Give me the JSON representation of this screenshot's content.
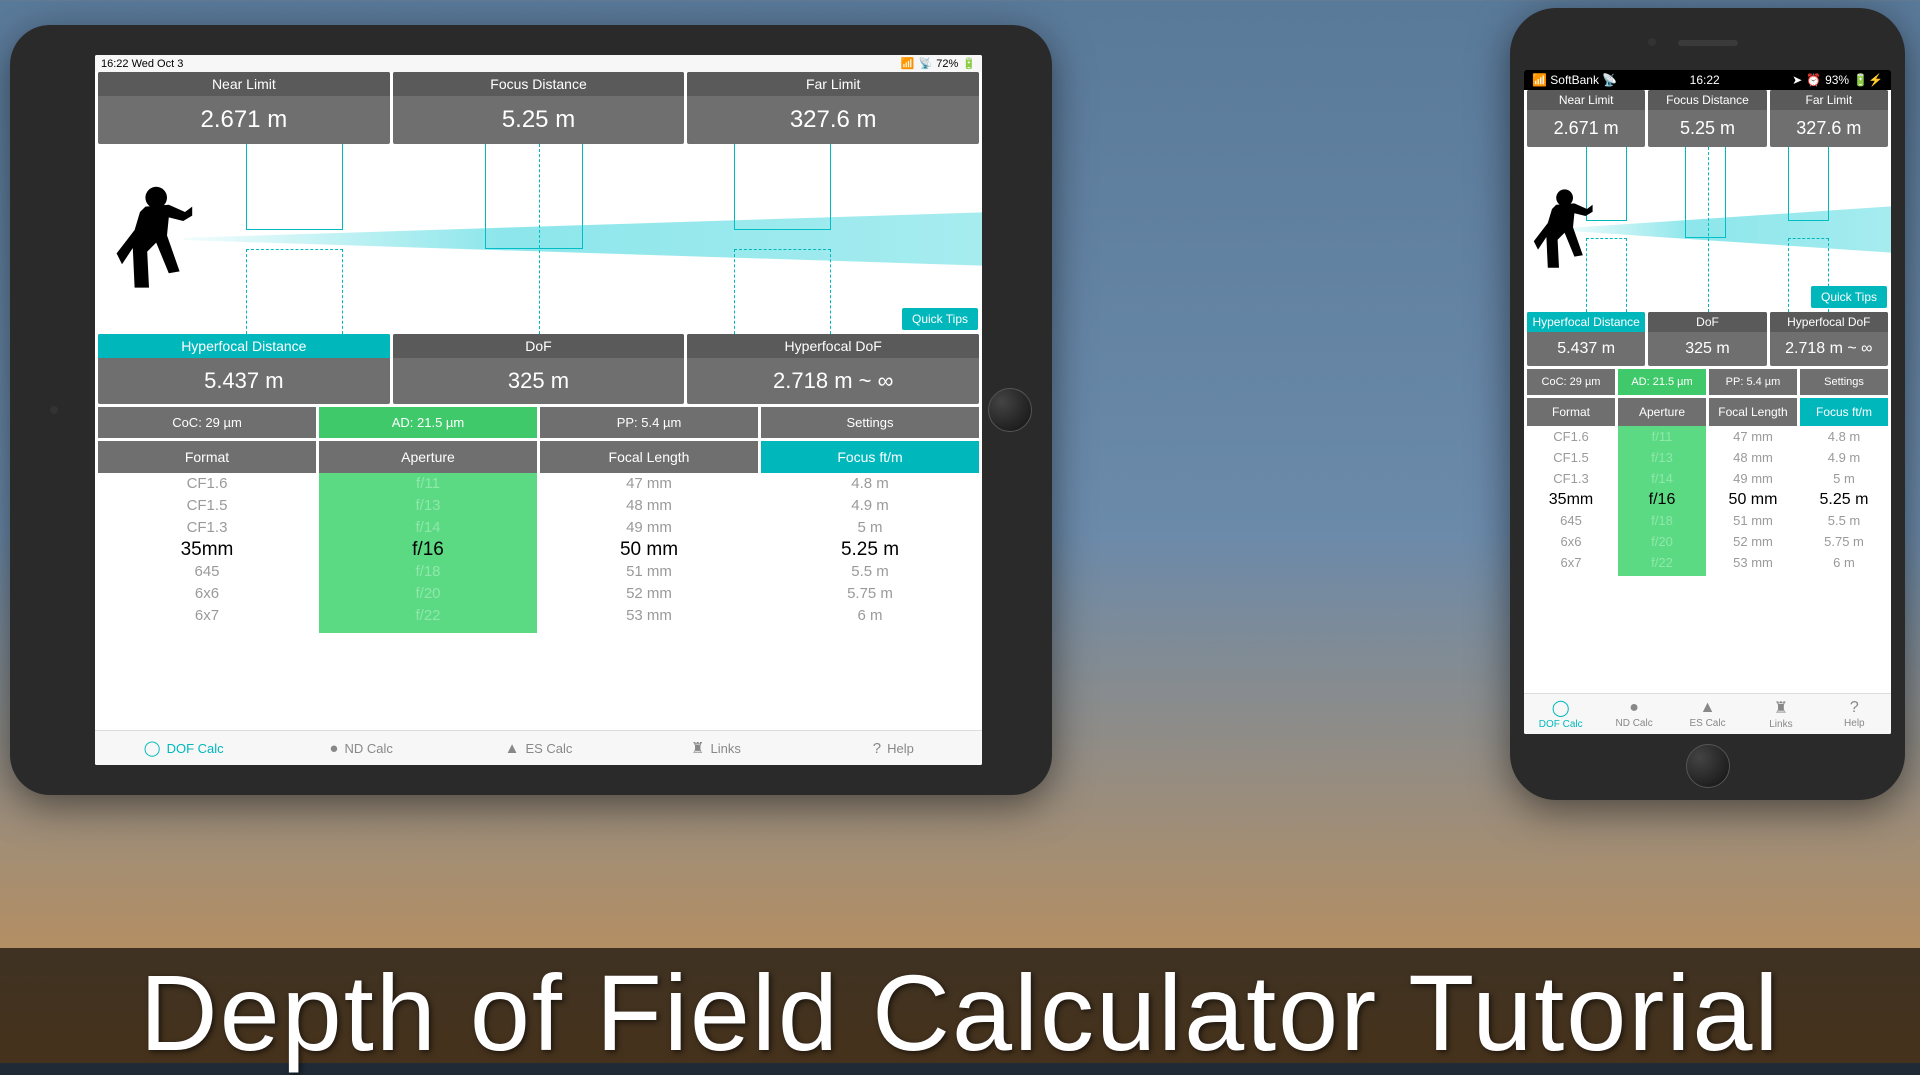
{
  "page_title": "Depth of Field Calculator Tutorial",
  "ipad": {
    "status": {
      "left": "16:22  Wed Oct 3",
      "right": "72%"
    }
  },
  "iphone": {
    "status": {
      "carrier": "SoftBank",
      "time": "16:22",
      "battery": "93%"
    }
  },
  "results_top": {
    "near": {
      "label": "Near Limit",
      "value": "2.671 m"
    },
    "focus": {
      "label": "Focus Distance",
      "value": "5.25 m"
    },
    "far": {
      "label": "Far Limit",
      "value": "327.6 m"
    }
  },
  "quick_tips_label": "Quick Tips",
  "results_mid": {
    "hyper": {
      "label": "Hyperfocal Distance",
      "value": "5.437 m"
    },
    "dof": {
      "label": "DoF",
      "value": "325 m"
    },
    "hdof": {
      "label": "Hyperfocal DoF",
      "value": "2.718 m ~ ∞"
    }
  },
  "settings_row": {
    "coc": "CoC: 29 µm",
    "ad": "AD: 21.5 µm",
    "pp": "PP: 5.4 µm",
    "settings": "Settings"
  },
  "picker_headers": {
    "format": "Format",
    "aperture": "Aperture",
    "focal": "Focal Length",
    "focus": "Focus ft/m"
  },
  "wheels": {
    "format": [
      "CF1.6",
      "CF1.5",
      "CF1.3",
      "35mm",
      "645",
      "6x6",
      "6x7"
    ],
    "aperture": [
      "f/11",
      "f/13",
      "f/14",
      "f/16",
      "f/18",
      "f/20",
      "f/22"
    ],
    "focal": [
      "47 mm",
      "48 mm",
      "49 mm",
      "50 mm",
      "51 mm",
      "52 mm",
      "53 mm"
    ],
    "focus": [
      "4.8 m",
      "4.9 m",
      "5 m",
      "5.25 m",
      "5.5 m",
      "5.75 m",
      "6 m"
    ],
    "selected_index": 3
  },
  "tabs": {
    "dof": "DOF Calc",
    "nd": "ND Calc",
    "es": "ES Calc",
    "links": "Links",
    "help": "Help"
  }
}
